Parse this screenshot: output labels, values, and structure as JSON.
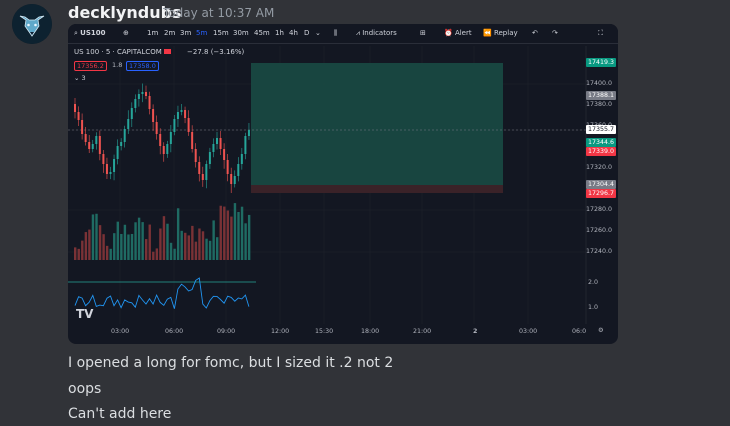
{
  "message": {
    "username": "decklyndubs",
    "timestamp": "Today at 10:37 AM",
    "lines": [
      "I opened a long for fomc, but I sized it .2 not 2",
      "oops",
      "Can't add here"
    ]
  },
  "chart": {
    "symbol_btn": "US100",
    "timeframes": [
      "1m",
      "2m",
      "3m",
      "5m",
      "15m",
      "30m",
      "45m",
      "1h",
      "4h",
      "D"
    ],
    "active_timeframe": "5m",
    "indicators_label": "Indicators",
    "alert_label": "Alert",
    "replay_label": "Replay",
    "title": "US 100 · 5 · CAPITALCOM",
    "change": "−27.8 (−3.16%)",
    "bid": "17356.2",
    "spread": "1.8",
    "ask": "17358.0",
    "volume_count": "3",
    "price_labels": [
      {
        "text": "17419.3",
        "color": "#089981"
      },
      {
        "text": "17388.1",
        "color": "#787b86"
      },
      {
        "text": "17355.7",
        "color": "#ffffff"
      },
      {
        "text": "17344.6",
        "color": "#089981"
      },
      {
        "text": "17339.0",
        "color": "#f23645"
      },
      {
        "text": "17304.4",
        "color": "#787b86"
      },
      {
        "text": "17296.7",
        "color": "#f23645"
      }
    ],
    "y_axis": [
      "17400.0",
      "17380.0",
      "17360.0",
      "17320.0",
      "17280.0",
      "17260.0",
      "17240.0",
      "2.0",
      "1.0"
    ],
    "x_axis": [
      "03:00",
      "06:00",
      "09:00",
      "12:00",
      "15:30",
      "18:00",
      "21:00",
      "2",
      "03:00",
      "06:0"
    ],
    "colors": {
      "long_zone": "#1a4a44",
      "stop_zone": "#3a2228",
      "up": "#26a69a",
      "down": "#ef5350",
      "accent": "#2962ff"
    }
  }
}
